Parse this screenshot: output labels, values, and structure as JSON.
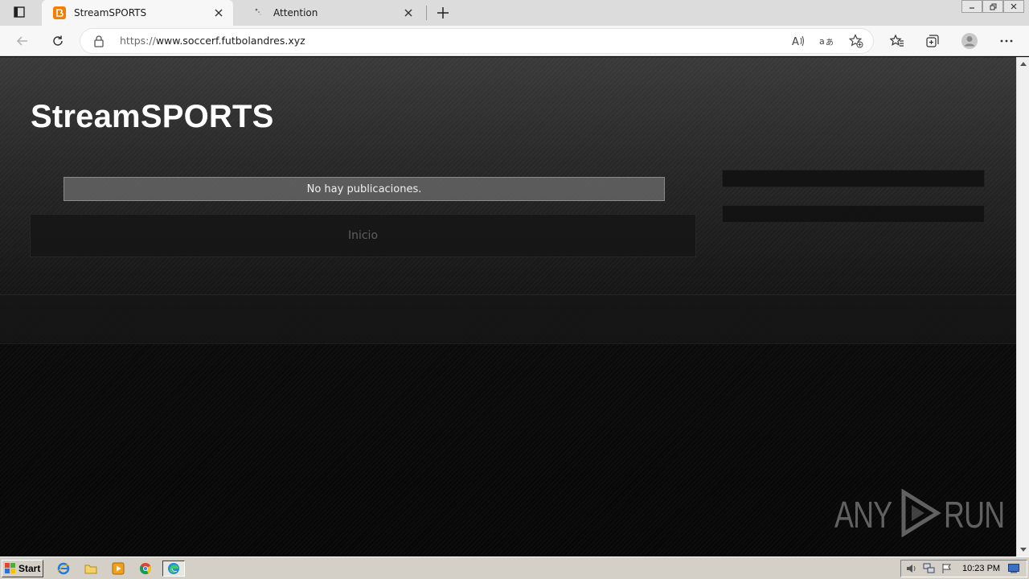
{
  "browser": {
    "tabs": [
      {
        "title": "StreamSPORTS",
        "active": true,
        "favicon": "blogger-icon"
      },
      {
        "title": "Attention",
        "active": false,
        "favicon": "loading-dots-icon"
      }
    ],
    "address": {
      "scheme": "https://",
      "host": "www.soccerf.futbolandres.xyz"
    },
    "accent_color": "#f57d00"
  },
  "page": {
    "blog_title": "StreamSPORTS",
    "status_message": "No hay publicaciones.",
    "home_link": "Inicio"
  },
  "watermark": {
    "left": "ANY",
    "right": "RUN"
  },
  "taskbar": {
    "start_label": "Start",
    "clock": "10:23 PM",
    "quick_launch": [
      "ie-icon",
      "folder-icon",
      "media-player-icon",
      "chrome-icon",
      "edge-icon"
    ]
  }
}
